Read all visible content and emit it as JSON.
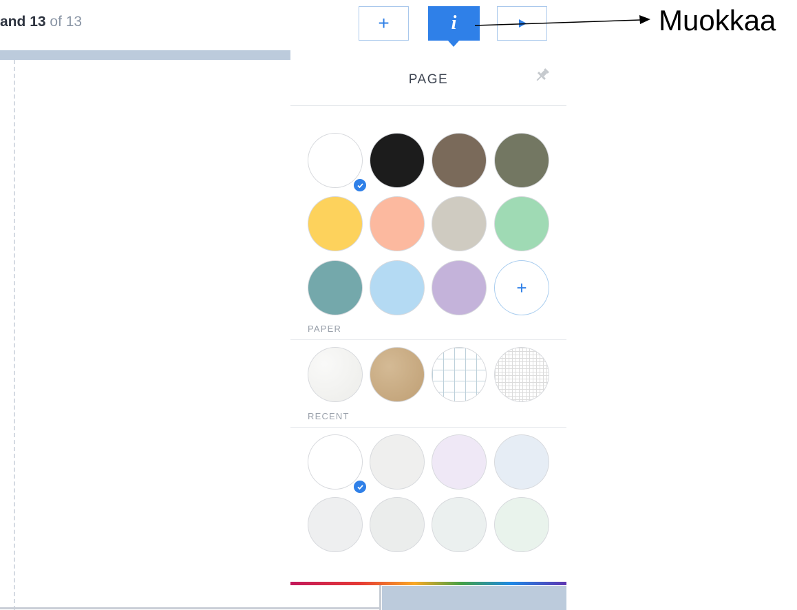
{
  "header": {
    "page_counter": {
      "prefix": "and",
      "current": "13",
      "of_label": "of",
      "total": "13"
    },
    "buttons": {
      "add_symbol": "+",
      "info_symbol": "i"
    }
  },
  "annotation": {
    "label": "Muokkaa"
  },
  "panel": {
    "title": "PAGE",
    "colors": [
      {
        "name": "white",
        "hex": "#ffffff",
        "selected": true
      },
      {
        "name": "black",
        "hex": "#1c1c1c"
      },
      {
        "name": "brown",
        "hex": "#7a6a5a"
      },
      {
        "name": "olive",
        "hex": "#737762"
      },
      {
        "name": "yellow",
        "hex": "#fdd25c"
      },
      {
        "name": "peach",
        "hex": "#fcb99f"
      },
      {
        "name": "stone",
        "hex": "#cfcbc1"
      },
      {
        "name": "mint",
        "hex": "#9fdab4"
      },
      {
        "name": "teal",
        "hex": "#74a8ab"
      },
      {
        "name": "light-blue",
        "hex": "#b4daf3"
      },
      {
        "name": "lavender",
        "hex": "#c4b3da"
      }
    ],
    "add_color_symbol": "+",
    "paper_label": "PAPER",
    "papers": [
      {
        "name": "white-textured-paper",
        "hex": "#f1f1ee"
      },
      {
        "name": "kraft-paper",
        "hex": "#c8ab84"
      },
      {
        "name": "large-grid-paper",
        "hex": "#ffffff"
      },
      {
        "name": "fine-grid-paper",
        "hex": "#ffffff"
      }
    ],
    "recent_label": "RECENT",
    "recent": [
      {
        "hex": "#ffffff",
        "selected": true
      },
      {
        "hex": "#efefee"
      },
      {
        "hex": "#efe8f6"
      },
      {
        "hex": "#e6edf5"
      },
      {
        "hex": "#eeeff0"
      },
      {
        "hex": "#ebedec"
      },
      {
        "hex": "#ebf0ef"
      },
      {
        "hex": "#e9f3ec"
      }
    ]
  }
}
